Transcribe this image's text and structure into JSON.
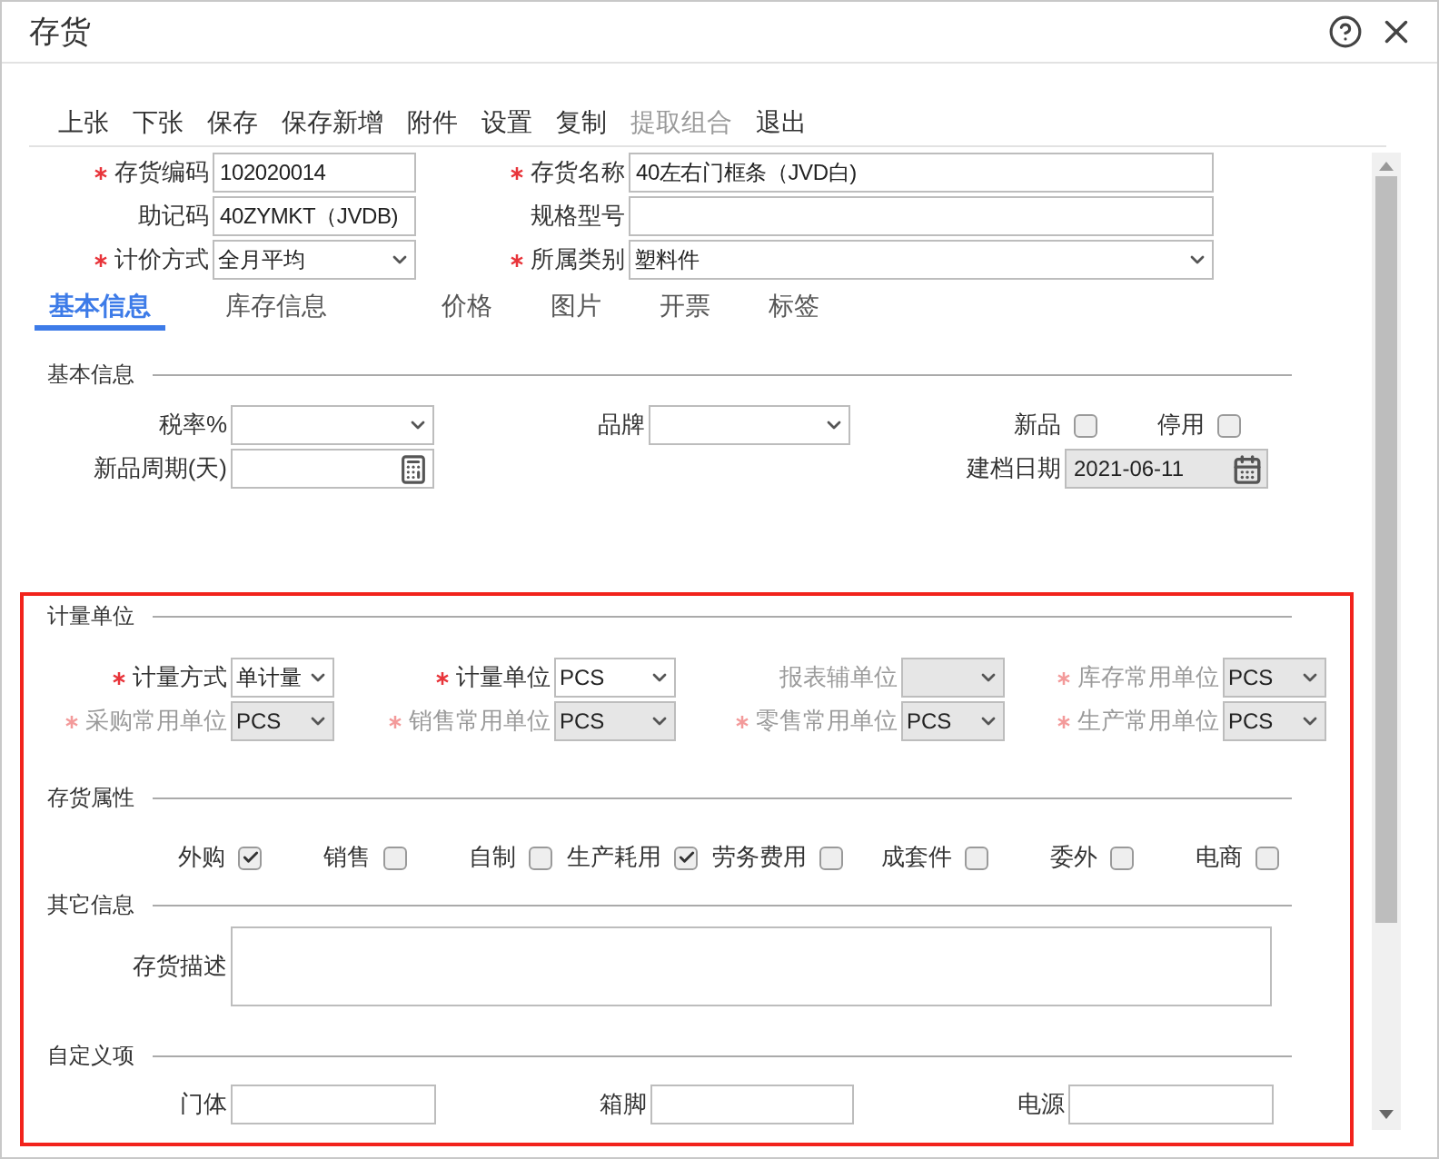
{
  "window": {
    "title": "存货"
  },
  "toolbar": [
    {
      "label": "上张",
      "disabled": false
    },
    {
      "label": "下张",
      "disabled": false
    },
    {
      "label": "保存",
      "disabled": false
    },
    {
      "label": "保存新增",
      "disabled": false
    },
    {
      "label": "附件",
      "disabled": false
    },
    {
      "label": "设置",
      "disabled": false
    },
    {
      "label": "复制",
      "disabled": false
    },
    {
      "label": "提取组合",
      "disabled": true
    },
    {
      "label": "退出",
      "disabled": false
    }
  ],
  "header_rows": [
    [
      {
        "label": "存货编码",
        "required": true,
        "disabled": false,
        "kind": "text",
        "value": "102020014"
      },
      {
        "label": "存货名称",
        "required": true,
        "disabled": false,
        "kind": "text",
        "value": "40左右门框条（JVD白)"
      }
    ],
    [
      {
        "label": "助记码",
        "required": false,
        "disabled": false,
        "kind": "text",
        "value": "40ZYMKT（JVDB)"
      },
      {
        "label": "规格型号",
        "required": false,
        "disabled": false,
        "kind": "text"
      }
    ],
    [
      {
        "label": "计价方式",
        "required": true,
        "disabled": false,
        "kind": "select",
        "value": "全月平均"
      },
      {
        "label": "所属类别",
        "required": true,
        "disabled": false,
        "kind": "select",
        "value": "塑料件"
      }
    ]
  ],
  "tabs": [
    {
      "label": "基本信息",
      "selected": true
    },
    {
      "label": "库存信息",
      "selected": false
    },
    {
      "label": "价格",
      "selected": false
    },
    {
      "label": "图片",
      "selected": false
    },
    {
      "label": "开票",
      "selected": false
    },
    {
      "label": "标签",
      "selected": false
    }
  ],
  "sections": [
    {
      "title": "基本信息",
      "rows": [
        [
          {
            "label": "税率%",
            "required": false,
            "disabled": false,
            "kind": "select"
          },
          {
            "label": "品牌",
            "required": false,
            "disabled": false,
            "kind": "select"
          },
          {
            "label": "新品",
            "kind": "checkbox",
            "checked": false
          },
          {
            "label": "停用",
            "kind": "checkbox",
            "checked": false
          }
        ],
        [
          {
            "label": "新品周期(天)",
            "required": false,
            "disabled": false,
            "kind": "number"
          },
          "",
          {
            "label": "建档日期",
            "required": false,
            "disabled": true,
            "kind": "date",
            "value": "2021-06-11"
          }
        ]
      ]
    },
    {
      "title": "计量单位",
      "rows": [
        [
          {
            "label": "计量方式",
            "required": true,
            "disabled": false,
            "kind": "select",
            "value": "单计量"
          },
          {
            "label": "计量单位",
            "required": true,
            "disabled": false,
            "kind": "select",
            "value": "PCS"
          },
          {
            "label": "报表辅单位",
            "required": false,
            "disabled": true,
            "kind": "select"
          },
          {
            "label": "库存常用单位",
            "required": true,
            "disabled": true,
            "kind": "select",
            "value": "PCS"
          }
        ],
        [
          {
            "label": "采购常用单位",
            "required": true,
            "disabled": true,
            "kind": "select",
            "value": "PCS"
          },
          {
            "label": "销售常用单位",
            "required": true,
            "disabled": true,
            "kind": "select",
            "value": "PCS"
          },
          {
            "label": "零售常用单位",
            "required": true,
            "disabled": true,
            "kind": "select",
            "value": "PCS"
          },
          {
            "label": "生产常用单位",
            "required": true,
            "disabled": true,
            "kind": "select",
            "value": "PCS"
          }
        ]
      ]
    },
    {
      "title": "存货属性",
      "rows": [
        [
          {
            "label": "外购",
            "kind": "checkbox",
            "checked": true
          },
          {
            "label": "销售",
            "kind": "checkbox",
            "checked": false
          },
          {
            "label": "自制",
            "kind": "checkbox",
            "checked": false
          },
          {
            "label": "生产耗用",
            "kind": "checkbox",
            "checked": true
          },
          {
            "label": "劳务费用",
            "kind": "checkbox",
            "checked": false
          },
          {
            "label": "成套件",
            "kind": "checkbox",
            "checked": false
          },
          {
            "label": "委外",
            "kind": "checkbox",
            "checked": false
          },
          {
            "label": "电商",
            "kind": "checkbox",
            "checked": false
          }
        ]
      ]
    },
    {
      "title": "其它信息",
      "rows": [
        [
          {
            "label": "存货描述",
            "required": false,
            "disabled": false,
            "kind": "textarea"
          }
        ]
      ]
    },
    {
      "title": "自定义项",
      "rows": [
        [
          {
            "label": "门体",
            "required": false,
            "disabled": false,
            "kind": "text"
          },
          {
            "label": "箱脚",
            "required": false,
            "disabled": false,
            "kind": "text"
          },
          {
            "label": "电源",
            "required": false,
            "disabled": false,
            "kind": "text"
          }
        ]
      ]
    }
  ]
}
